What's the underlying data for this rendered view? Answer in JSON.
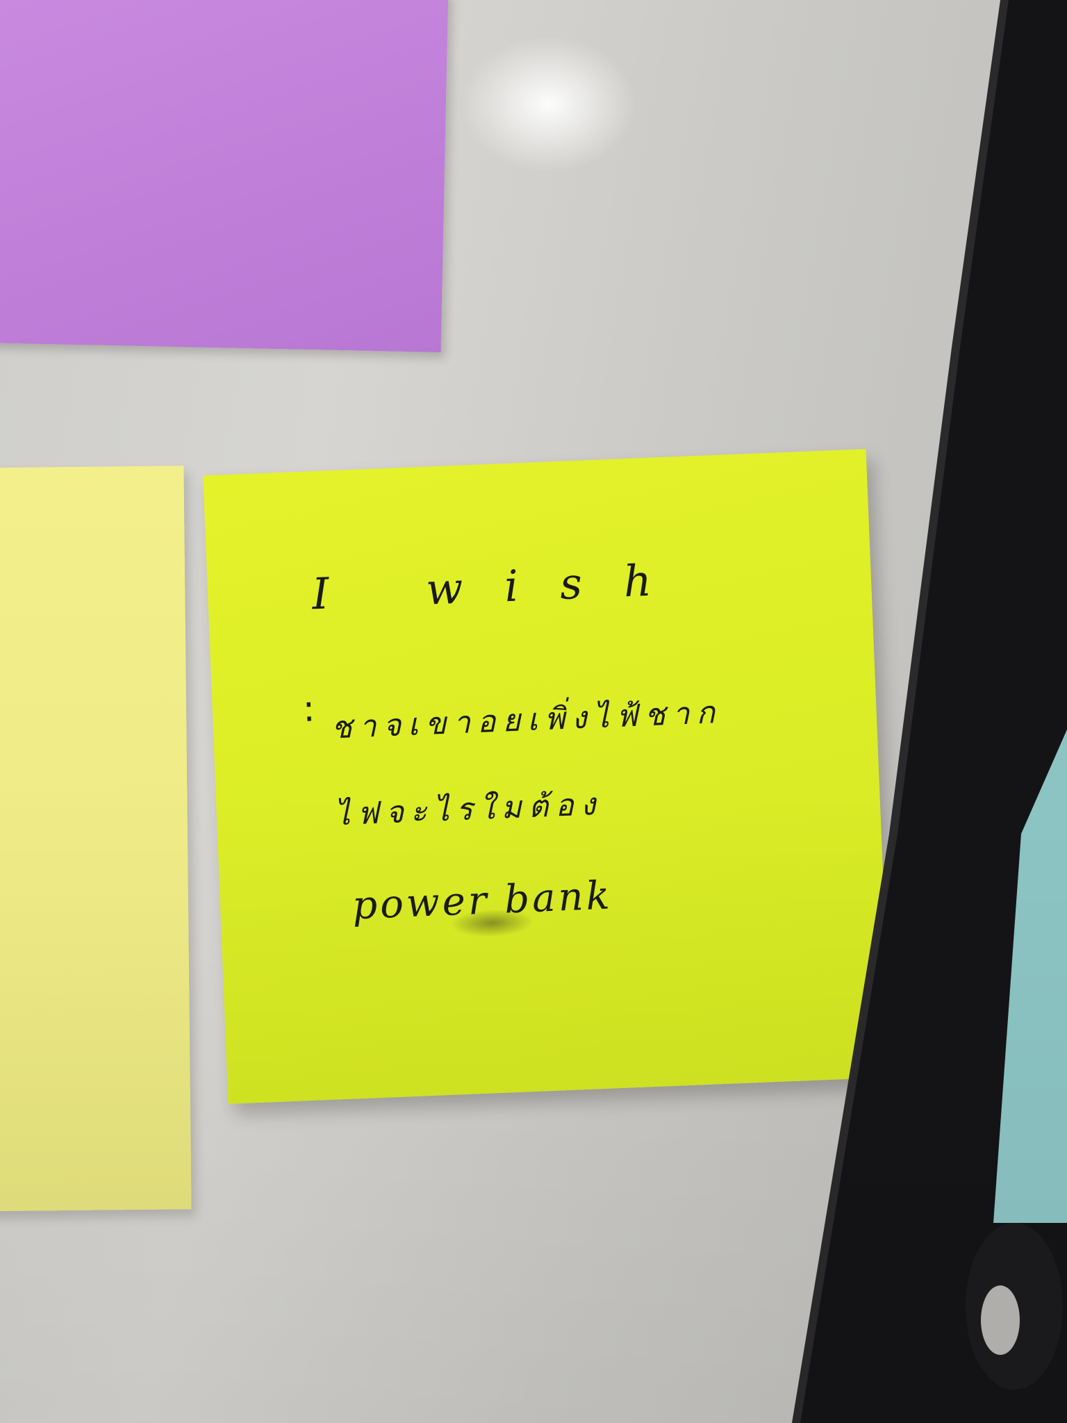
{
  "scene": {
    "description_colors": {
      "board": "#d2d1cd",
      "frame": "#141416",
      "purple_note": "#c586dd",
      "pale_yellow_note": "#f0ed88",
      "main_note": "#dcee26",
      "ink": "#1a1a14"
    }
  },
  "note": {
    "line1": "I wish",
    "colon": ":",
    "line2": "ชาจเขาอยเพิ่งไฟ้ชาก",
    "line3": "ไฟจะไรใมต้อง",
    "line4": "power bank"
  }
}
